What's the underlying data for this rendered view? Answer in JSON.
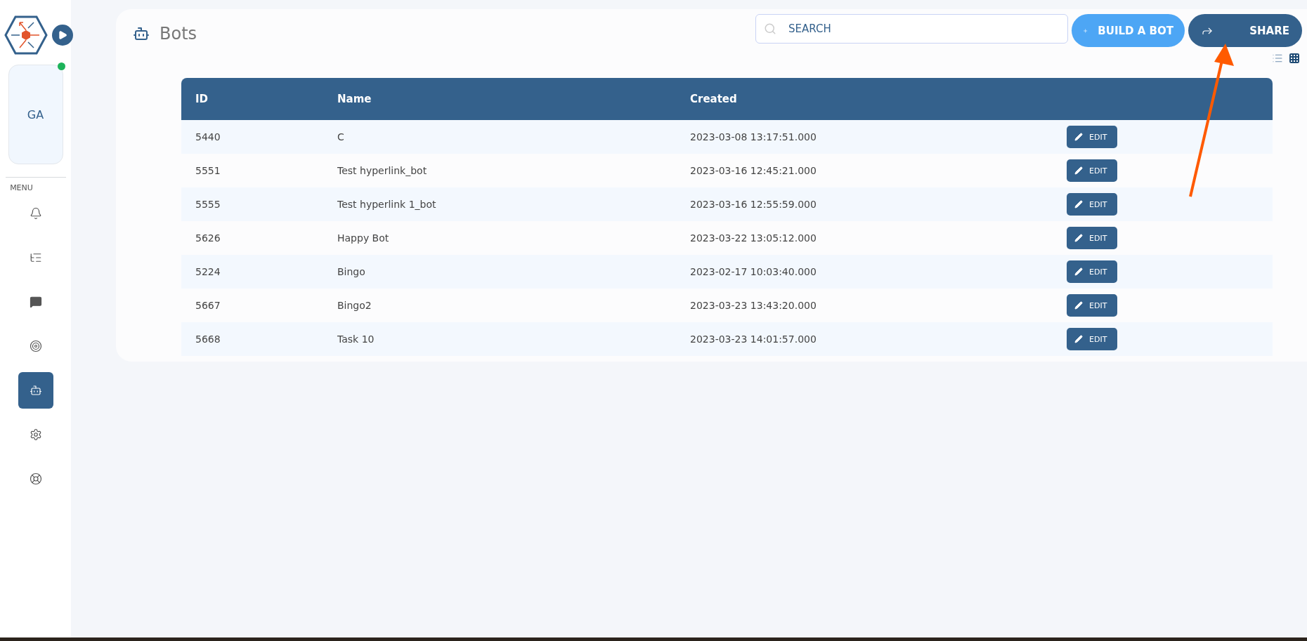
{
  "sidebar": {
    "profile": {
      "initials": "GA",
      "online": true
    },
    "menu_label": "MENU",
    "items": [
      {
        "kind": "bell",
        "selected": false
      },
      {
        "kind": "list",
        "selected": false
      },
      {
        "kind": "chat",
        "selected": false
      },
      {
        "kind": "target",
        "selected": false
      },
      {
        "kind": "robot",
        "selected": true
      },
      {
        "kind": "gear",
        "selected": false
      },
      {
        "kind": "lifebuoy",
        "selected": false
      }
    ]
  },
  "page": {
    "title": "Bots"
  },
  "search": {
    "placeholder": "SEARCH"
  },
  "buttons": {
    "build": "BUILD A BOT",
    "share": "SHARE"
  },
  "view_toggle": [
    {
      "kind": "list",
      "selected": false
    },
    {
      "kind": "grid",
      "selected": true
    }
  ],
  "table": {
    "columns": [
      "ID",
      "Name",
      "Created"
    ],
    "rows": [
      {
        "id": "5440",
        "name": "C",
        "created": "2023-03-08 13:17:51.000",
        "action": "EDIT"
      },
      {
        "id": "5551",
        "name": "Test hyperlink_bot",
        "created": "2023-03-16 12:45:21.000",
        "action": "EDIT"
      },
      {
        "id": "5555",
        "name": "Test hyperlink 1_bot",
        "created": "2023-03-16 12:55:59.000",
        "action": "EDIT"
      },
      {
        "id": "5626",
        "name": "Happy Bot",
        "created": "2023-03-22 13:05:12.000",
        "action": "EDIT"
      },
      {
        "id": "5224",
        "name": "Bingo",
        "created": "2023-02-17 10:03:40.000",
        "action": "EDIT"
      },
      {
        "id": "5667",
        "name": "Bingo2",
        "created": "2023-03-23 13:43:20.000",
        "action": "EDIT"
      },
      {
        "id": "5668",
        "name": "Task 10",
        "created": "2023-03-23 14:01:57.000",
        "action": "EDIT"
      }
    ]
  }
}
